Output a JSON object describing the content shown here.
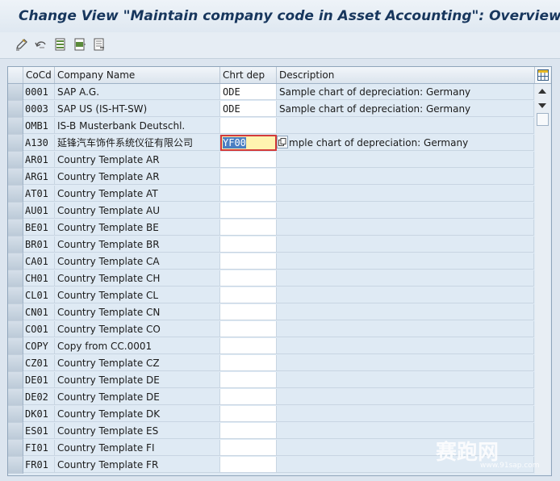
{
  "title": "Change View \"Maintain company code in Asset Accounting\": Overview",
  "toolbar": {
    "icons": [
      "edit-pen-icon",
      "undo-icon",
      "select-all-icon",
      "select-block-icon",
      "deselect-all-icon"
    ]
  },
  "table": {
    "headers": [
      "CoCd",
      "Company Name",
      "Chrt dep",
      "Description"
    ],
    "rows": [
      {
        "cocd": "0001",
        "name": "SAP A.G.",
        "chrt": "ODE",
        "desc": "Sample chart of depreciation: Germany"
      },
      {
        "cocd": "0003",
        "name": "SAP US (IS-HT-SW)",
        "chrt": "ODE",
        "desc": "Sample chart of depreciation: Germany"
      },
      {
        "cocd": "OMB1",
        "name": "IS-B Musterbank Deutschl.",
        "chrt": "",
        "desc": ""
      },
      {
        "cocd": "A130",
        "name": "延锋汽车饰件系统仪征有限公司",
        "chrt": "YF00",
        "desc": "mple chart of depreciation: Germany"
      },
      {
        "cocd": "AR01",
        "name": "Country Template AR",
        "chrt": "",
        "desc": ""
      },
      {
        "cocd": "ARG1",
        "name": "Country Template AR",
        "chrt": "",
        "desc": ""
      },
      {
        "cocd": "AT01",
        "name": "Country Template AT",
        "chrt": "",
        "desc": ""
      },
      {
        "cocd": "AU01",
        "name": "Country Template AU",
        "chrt": "",
        "desc": ""
      },
      {
        "cocd": "BE01",
        "name": "Country Template BE",
        "chrt": "",
        "desc": ""
      },
      {
        "cocd": "BR01",
        "name": "Country Template BR",
        "chrt": "",
        "desc": ""
      },
      {
        "cocd": "CA01",
        "name": "Country Template CA",
        "chrt": "",
        "desc": ""
      },
      {
        "cocd": "CH01",
        "name": "Country Template CH",
        "chrt": "",
        "desc": ""
      },
      {
        "cocd": "CL01",
        "name": "Country Template CL",
        "chrt": "",
        "desc": ""
      },
      {
        "cocd": "CN01",
        "name": "Country Template CN",
        "chrt": "",
        "desc": ""
      },
      {
        "cocd": "CO01",
        "name": "Country Template CO",
        "chrt": "",
        "desc": ""
      },
      {
        "cocd": "COPY",
        "name": "Copy from CC.0001",
        "chrt": "",
        "desc": ""
      },
      {
        "cocd": "CZ01",
        "name": "Country Template CZ",
        "chrt": "",
        "desc": ""
      },
      {
        "cocd": "DE01",
        "name": "Country Template DE",
        "chrt": "",
        "desc": ""
      },
      {
        "cocd": "DE02",
        "name": "Country Template DE",
        "chrt": "",
        "desc": ""
      },
      {
        "cocd": "DK01",
        "name": "Country Template DK",
        "chrt": "",
        "desc": ""
      },
      {
        "cocd": "ES01",
        "name": "Country Template ES",
        "chrt": "",
        "desc": ""
      },
      {
        "cocd": "FI01",
        "name": "Country Template FI",
        "chrt": "",
        "desc": ""
      },
      {
        "cocd": "FR01",
        "name": "Country Template FR",
        "chrt": "",
        "desc": ""
      }
    ]
  },
  "focused_row": 3,
  "watermark": {
    "text": "赛跑网",
    "url": "www.91sap.com"
  },
  "colors": {
    "title": "#17365d",
    "focus_border": "#d33a3a",
    "focus_bg": "#fff3b0",
    "selection": "#4a7ec2"
  }
}
